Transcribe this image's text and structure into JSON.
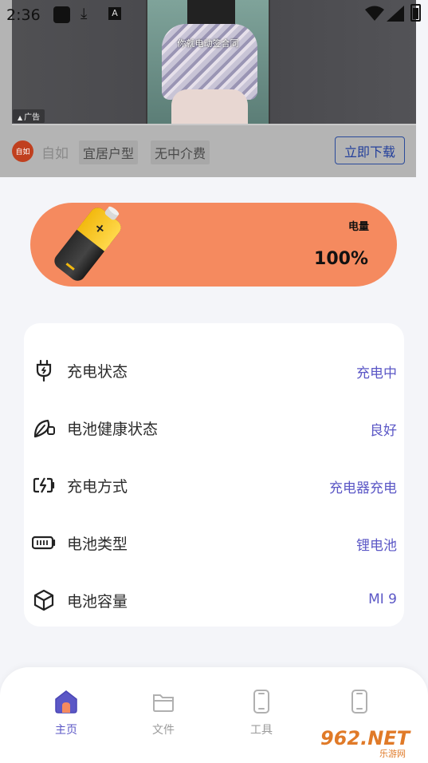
{
  "status_bar": {
    "time": "2:36"
  },
  "ad": {
    "video_caption": "你就电动签合同",
    "tag": "广告",
    "logo_text": "自如",
    "brand": "自如",
    "chips": [
      "宜居户型",
      "无中介费"
    ],
    "cta": "立即下载"
  },
  "battery": {
    "title": "电量",
    "value": "100%",
    "level_percent": 100,
    "accent": "#f58a5f"
  },
  "info_rows": [
    {
      "label": "充电状态",
      "value": "充电中",
      "icon": "plug-icon"
    },
    {
      "label": "电池健康状态",
      "value": "良好",
      "icon": "leaf-health-icon"
    },
    {
      "label": "充电方式",
      "value": "充电器充电",
      "icon": "charging-battery-icon"
    },
    {
      "label": "电池类型",
      "value": "锂电池",
      "icon": "battery-type-icon"
    },
    {
      "label": "电池容量",
      "value": "MI 9",
      "icon": "cube-icon"
    }
  ],
  "nav": {
    "items": [
      {
        "label": "主页",
        "icon": "home-icon",
        "active": true
      },
      {
        "label": "文件",
        "icon": "folder-icon",
        "active": false
      },
      {
        "label": "工具",
        "icon": "phone-icon",
        "active": false
      },
      {
        "label": "",
        "icon": "phone-icon",
        "active": false
      }
    ]
  },
  "watermark": {
    "text": "962.NET",
    "subtext": "乐游网"
  },
  "colors": {
    "accent": "#5b57c6",
    "background": "#f4f5f9"
  }
}
